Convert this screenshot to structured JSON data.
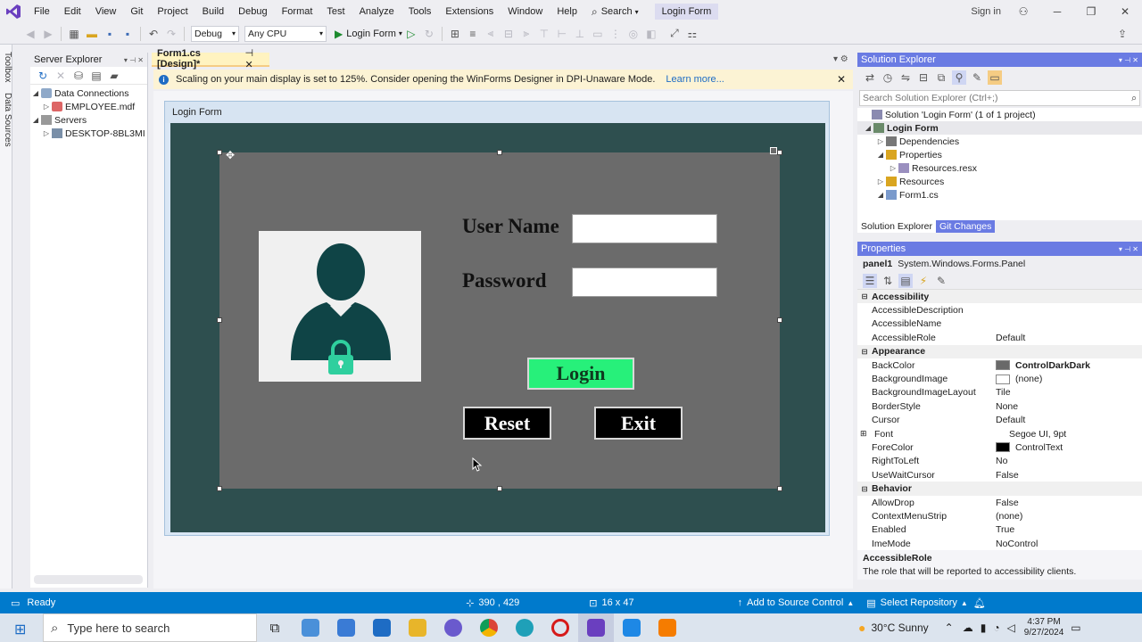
{
  "menu": {
    "items": [
      "File",
      "Edit",
      "View",
      "Git",
      "Project",
      "Build",
      "Debug",
      "Format",
      "Test",
      "Analyze",
      "Tools",
      "Extensions",
      "Window",
      "Help"
    ],
    "search_label": "Search",
    "solution_title": "Login Form",
    "sign_in": "Sign in"
  },
  "toolbar": {
    "config": "Debug",
    "platform": "Any CPU",
    "run_label": "Login Form"
  },
  "left_strip": {
    "toolbox": "Toolbox",
    "data_sources": "Data Sources"
  },
  "server_explorer": {
    "title": "Server Explorer",
    "items": [
      {
        "label": "Data Connections"
      },
      {
        "label": "EMPLOYEE.mdf"
      },
      {
        "label": "Servers"
      },
      {
        "label": "DESKTOP-8BL3MI"
      }
    ]
  },
  "document": {
    "tab_label": "Form1.cs [Design]*",
    "info_message": "Scaling on your main display is set to 125%. Consider opening the WinForms Designer in DPI-Unaware Mode.",
    "info_link": "Learn more...",
    "form_title": "Login Form"
  },
  "login_form": {
    "username_label": "User Name",
    "password_label": "Password",
    "login_button": "Login",
    "reset_button": "Reset",
    "exit_button": "Exit"
  },
  "solution_explorer": {
    "title": "Solution Explorer",
    "search_placeholder": "Search Solution Explorer (Ctrl+;)",
    "items": [
      {
        "label": "Solution 'Login Form' (1 of 1 project)"
      },
      {
        "label": "Login Form"
      },
      {
        "label": "Dependencies"
      },
      {
        "label": "Properties"
      },
      {
        "label": "Resources.resx"
      },
      {
        "label": "Resources"
      },
      {
        "label": "Form1.cs"
      }
    ],
    "tabs": [
      "Solution Explorer",
      "Git Changes"
    ]
  },
  "properties": {
    "title": "Properties",
    "object_name": "panel1",
    "object_type": "System.Windows.Forms.Panel",
    "rows": [
      {
        "cat": true,
        "name": "Accessibility"
      },
      {
        "name": "AccessibleDescription",
        "value": ""
      },
      {
        "name": "AccessibleName",
        "value": ""
      },
      {
        "name": "AccessibleRole",
        "value": "Default"
      },
      {
        "cat": true,
        "name": "Appearance"
      },
      {
        "name": "BackColor",
        "value": "ControlDarkDark",
        "swatch": "#696969",
        "bold": true
      },
      {
        "name": "BackgroundImage",
        "value": "(none)",
        "swatch": "#ffffff"
      },
      {
        "name": "BackgroundImageLayout",
        "value": "Tile"
      },
      {
        "name": "BorderStyle",
        "value": "None"
      },
      {
        "name": "Cursor",
        "value": "Default"
      },
      {
        "name": "Font",
        "value": "Segoe UI, 9pt",
        "expand": true
      },
      {
        "name": "ForeColor",
        "value": "ControlText",
        "swatch": "#000000"
      },
      {
        "name": "RightToLeft",
        "value": "No"
      },
      {
        "name": "UseWaitCursor",
        "value": "False"
      },
      {
        "cat": true,
        "name": "Behavior"
      },
      {
        "name": "AllowDrop",
        "value": "False"
      },
      {
        "name": "ContextMenuStrip",
        "value": "(none)"
      },
      {
        "name": "Enabled",
        "value": "True"
      },
      {
        "name": "ImeMode",
        "value": "NoControl"
      }
    ],
    "desc_title": "AccessibleRole",
    "desc_text": "The role that will be reported to accessibility clients."
  },
  "status": {
    "ready": "Ready",
    "position": "390 , 429",
    "size": "16 x 47",
    "add_source": "Add to Source Control",
    "select_repo": "Select Repository"
  },
  "taskbar": {
    "search_placeholder": "Type here to search",
    "weather": "30°C  Sunny",
    "time": "4:37 PM",
    "date": "9/27/2024"
  },
  "colors": {
    "form_back": "#2e4f4f",
    "panel_back": "#6b6b6b",
    "login_button": "#27f07a",
    "vs_purple": "#6a3fbf",
    "status_blue": "#007acc"
  }
}
